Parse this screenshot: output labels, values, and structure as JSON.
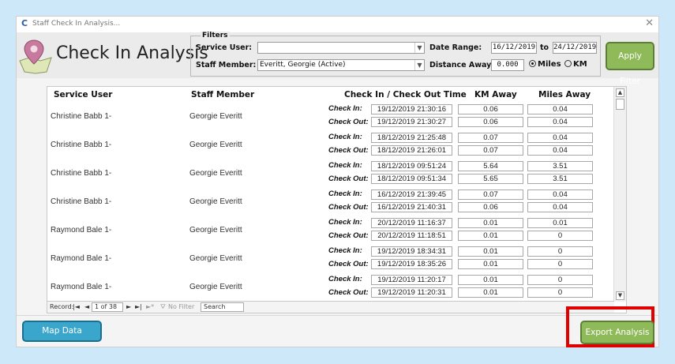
{
  "window": {
    "title": "Staff Check In Analysis..."
  },
  "header": {
    "title": "Check In Analysis"
  },
  "filters": {
    "legend": "Filters",
    "service_user_label": "Service User:",
    "service_user_value": "",
    "staff_member_label": "Staff Member:",
    "staff_member_value": "Everitt, Georgie (Active)",
    "date_range_label": "Date Range:",
    "date_from": "16/12/2019",
    "to_label": "to",
    "date_to": "24/12/2019",
    "distance_label": "Distance Away:",
    "distance_value": "0.000",
    "miles_label": "Miles",
    "km_label": "KM",
    "unit_selected": "Miles"
  },
  "buttons": {
    "apply_filter": "Apply Filter",
    "map_data": "Map Data",
    "export_analysis": "Export Analysis"
  },
  "table": {
    "headers": {
      "service_user": "Service User",
      "staff_member": "Staff Member",
      "check_time": "Check In / Check Out Time",
      "km_away": "KM Away",
      "miles_away": "Miles Away"
    },
    "check_in_label": "Check In:",
    "check_out_label": "Check Out:",
    "rows": [
      {
        "service_user": "Christine Babb 1-",
        "staff_member": "Georgie Everitt",
        "check_in": "19/12/2019 21:30:16",
        "check_out": "19/12/2019 21:30:27",
        "km_in": "0.06",
        "km_out": "0.06",
        "miles_in": "0.04",
        "miles_out": "0.04"
      },
      {
        "service_user": "Christine Babb 1-",
        "staff_member": "Georgie Everitt",
        "check_in": "18/12/2019 21:25:48",
        "check_out": "18/12/2019 21:26:01",
        "km_in": "0.07",
        "km_out": "0.07",
        "miles_in": "0.04",
        "miles_out": "0.04"
      },
      {
        "service_user": "Christine Babb 1-",
        "staff_member": "Georgie Everitt",
        "check_in": "18/12/2019 09:51:24",
        "check_out": "18/12/2019 09:51:34",
        "km_in": "5.64",
        "km_out": "5.65",
        "miles_in": "3.51",
        "miles_out": "3.51"
      },
      {
        "service_user": "Christine Babb 1-",
        "staff_member": "Georgie Everitt",
        "check_in": "16/12/2019 21:39:45",
        "check_out": "16/12/2019 21:40:31",
        "km_in": "0.07",
        "km_out": "0.06",
        "miles_in": "0.04",
        "miles_out": "0.04"
      },
      {
        "service_user": "Raymond Bale 1-",
        "staff_member": "Georgie Everitt",
        "check_in": "20/12/2019 11:16:37",
        "check_out": "20/12/2019 11:18:51",
        "km_in": "0.01",
        "km_out": "0.01",
        "miles_in": "0.01",
        "miles_out": "0"
      },
      {
        "service_user": "Raymond Bale 1-",
        "staff_member": "Georgie Everitt",
        "check_in": "19/12/2019 18:34:31",
        "check_out": "19/12/2019 18:35:26",
        "km_in": "0.01",
        "km_out": "0.01",
        "miles_in": "0",
        "miles_out": "0"
      },
      {
        "service_user": "Raymond Bale 1-",
        "staff_member": "Georgie Everitt",
        "check_in": "19/12/2019 11:20:17",
        "check_out": "19/12/2019 11:20:31",
        "km_in": "0.01",
        "km_out": "0.01",
        "miles_in": "0",
        "miles_out": "0"
      }
    ]
  },
  "record_nav": {
    "label": "Record:",
    "position": "1 of 38",
    "no_filter": "No Filter",
    "search": "Search"
  },
  "colors": {
    "accent_green": "#8fba5a",
    "accent_blue": "#3aa6cc",
    "highlight_red": "#e00000",
    "background": "#cde8f8"
  },
  "icons": {
    "app": "app-c-icon",
    "pin": "map-pin-icon",
    "close": "close-icon"
  }
}
